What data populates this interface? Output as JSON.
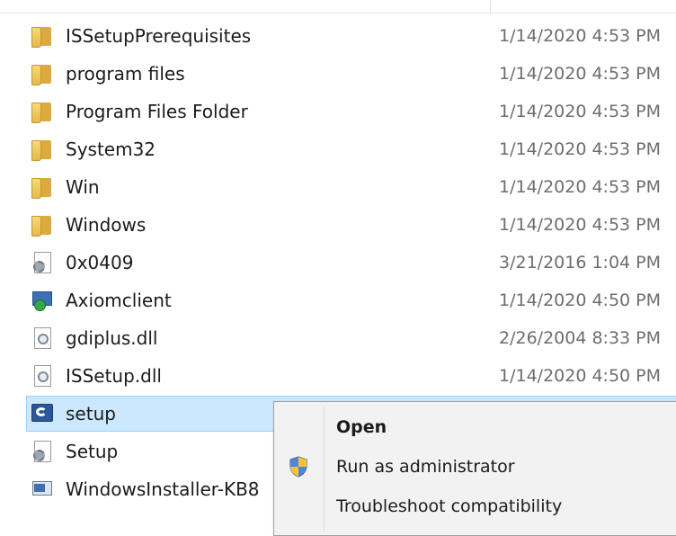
{
  "files": [
    {
      "name": "ISSetupPrerequisites",
      "date": "1/14/2020 4:53 PM",
      "icon": "folder-icon"
    },
    {
      "name": "program files",
      "date": "1/14/2020 4:53 PM",
      "icon": "folder-icon"
    },
    {
      "name": "Program Files Folder",
      "date": "1/14/2020 4:53 PM",
      "icon": "folder-icon"
    },
    {
      "name": "System32",
      "date": "1/14/2020 4:53 PM",
      "icon": "folder-icon"
    },
    {
      "name": "Win",
      "date": "1/14/2020 4:53 PM",
      "icon": "folder-icon"
    },
    {
      "name": "Windows",
      "date": "1/14/2020 4:53 PM",
      "icon": "folder-icon"
    },
    {
      "name": "0x0409",
      "date": "3/21/2016 1:04 PM",
      "icon": "settings-file-icon"
    },
    {
      "name": "Axiomclient",
      "date": "1/14/2020 4:50 PM",
      "icon": "installer-icon"
    },
    {
      "name": "gdiplus.dll",
      "date": "2/26/2004 8:33 PM",
      "icon": "dll-file-icon"
    },
    {
      "name": "ISSetup.dll",
      "date": "1/14/2020 4:50 PM",
      "icon": "dll-file-icon"
    },
    {
      "name": "setup",
      "date": "",
      "icon": "setup-app-icon"
    },
    {
      "name": "Setup",
      "date": "",
      "icon": "settings-file-icon"
    },
    {
      "name": "WindowsInstaller-KB8",
      "date": "",
      "icon": "msu-icon"
    }
  ],
  "context_menu": {
    "items": [
      {
        "label": "Open",
        "default": true
      },
      {
        "label": "Run as administrator",
        "icon": "uac-shield-icon"
      },
      {
        "label": "Troubleshoot compatibility"
      }
    ]
  },
  "colors": {
    "selection_bg": "#cce8ff",
    "date_text": "#6d6d6d",
    "menu_bg": "#f2f2f2"
  }
}
